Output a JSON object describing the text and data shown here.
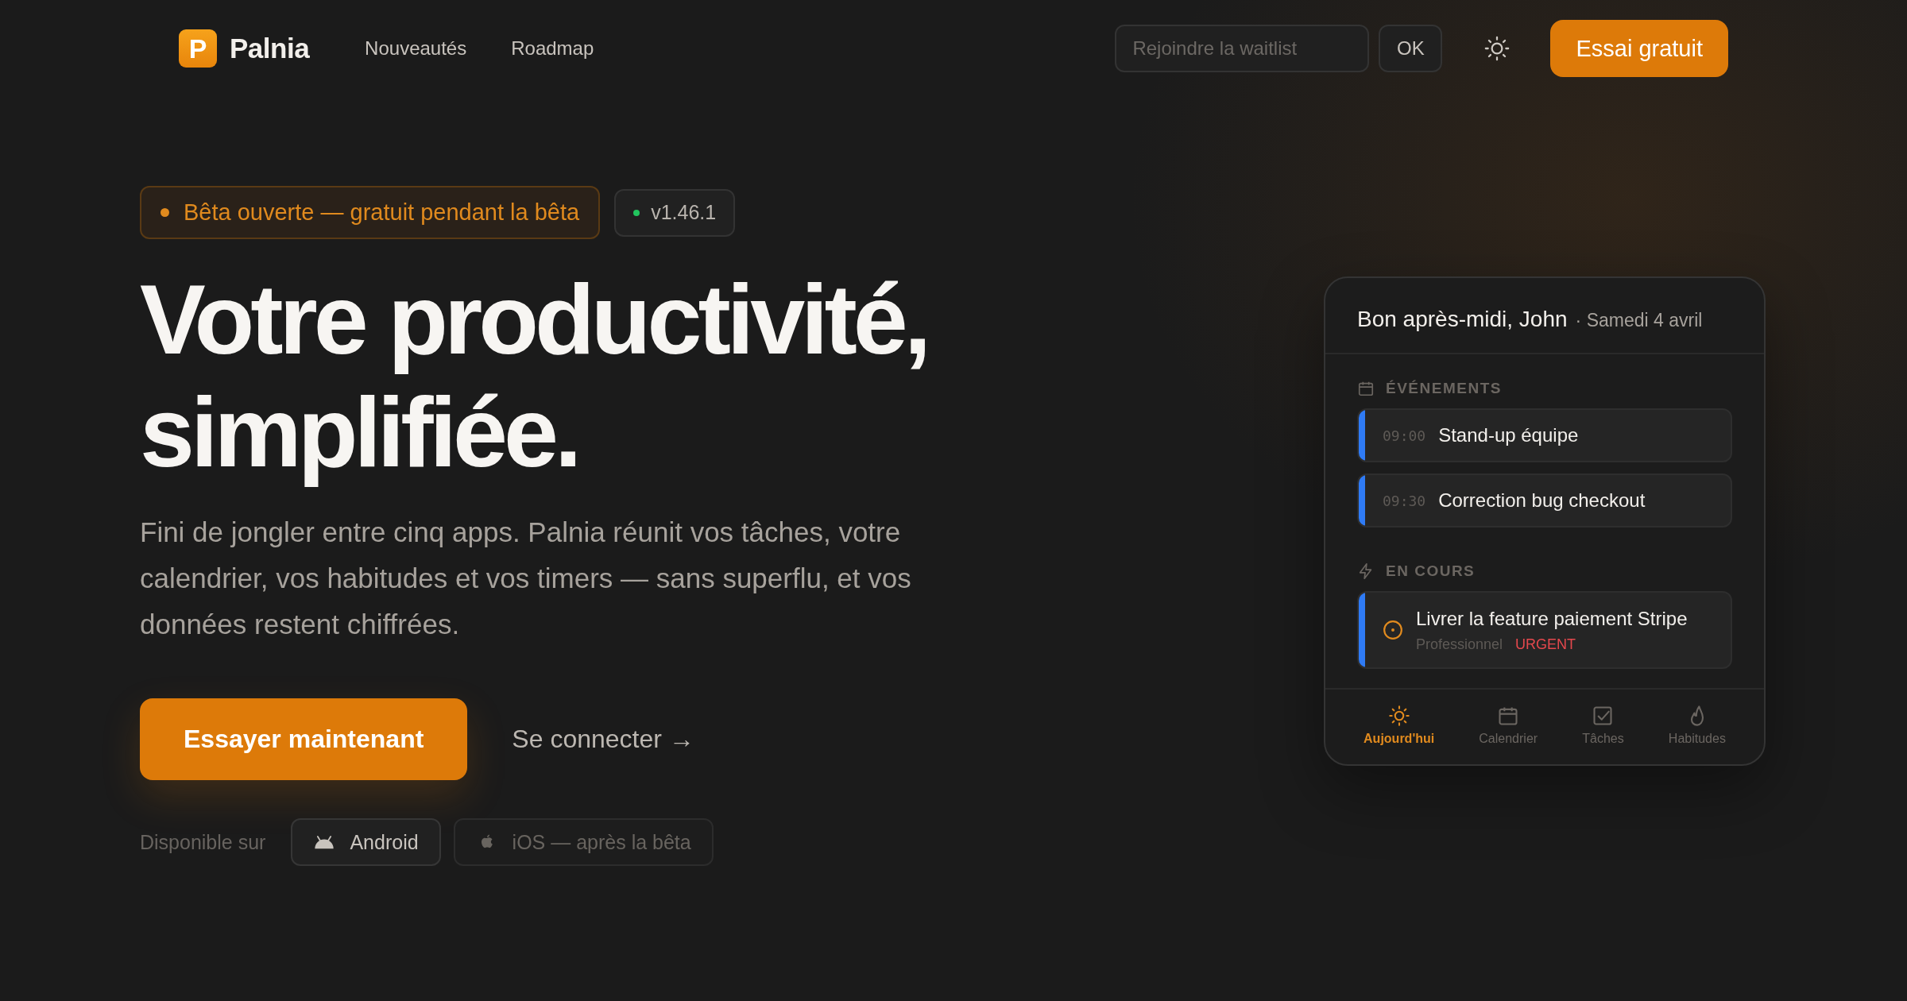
{
  "header": {
    "logo_letter": "P",
    "brand": "Palnia",
    "nav": [
      {
        "label": "Nouveautés"
      },
      {
        "label": "Roadmap"
      }
    ],
    "waitlist": {
      "placeholder": "Rejoindre la waitlist",
      "button": "OK"
    },
    "cta": "Essai gratuit"
  },
  "hero": {
    "badges": [
      {
        "kind": "beta",
        "label": "Bêta ouverte — gratuit pendant la bêta",
        "color": "#e08a1e"
      },
      {
        "kind": "version",
        "label": "v1.46.1",
        "color": "#22c55e"
      }
    ],
    "title_lines": [
      "Votre productivité,",
      "simplifiée."
    ],
    "description": "Fini de jongler entre cinq apps. Palnia réunit vos tâches, votre calendrier, vos habitudes et vos timers — sans superflu, et vos données restent chiffrées.",
    "primary_button": "Essayer maintenant",
    "secondary_link": "Se connecter →",
    "available_label": "Disponible sur",
    "platforms": [
      {
        "kind": "android",
        "label": "Android",
        "disabled": false
      },
      {
        "kind": "ios",
        "label": "iOS — après la bêta",
        "disabled": true
      }
    ]
  },
  "preview": {
    "greeting": "Bon après-midi, John",
    "date": "· Samedi 4 avril",
    "sections": [
      {
        "kind": "events",
        "heading": "ÉVÉNEMENTS",
        "items": [
          {
            "time": "09:00",
            "title": "Stand-up équipe",
            "color": "#2f7bf5"
          },
          {
            "time": "09:30",
            "title": "Correction bug checkout",
            "color": "#2f7bf5"
          }
        ]
      },
      {
        "kind": "tasks",
        "heading": "EN COURS",
        "items": [
          {
            "title": "Livrer la feature paiement Stripe",
            "category": "Professionnel",
            "priority": "URGENT",
            "color": "#2f7bf5"
          }
        ]
      }
    ],
    "tabs": [
      {
        "kind": "today",
        "label": "Aujourd'hui",
        "selected": true
      },
      {
        "kind": "calendar",
        "label": "Calendrier",
        "selected": false
      },
      {
        "kind": "tasks",
        "label": "Tâches",
        "selected": false
      },
      {
        "kind": "habits",
        "label": "Habitudes",
        "selected": false
      }
    ]
  }
}
